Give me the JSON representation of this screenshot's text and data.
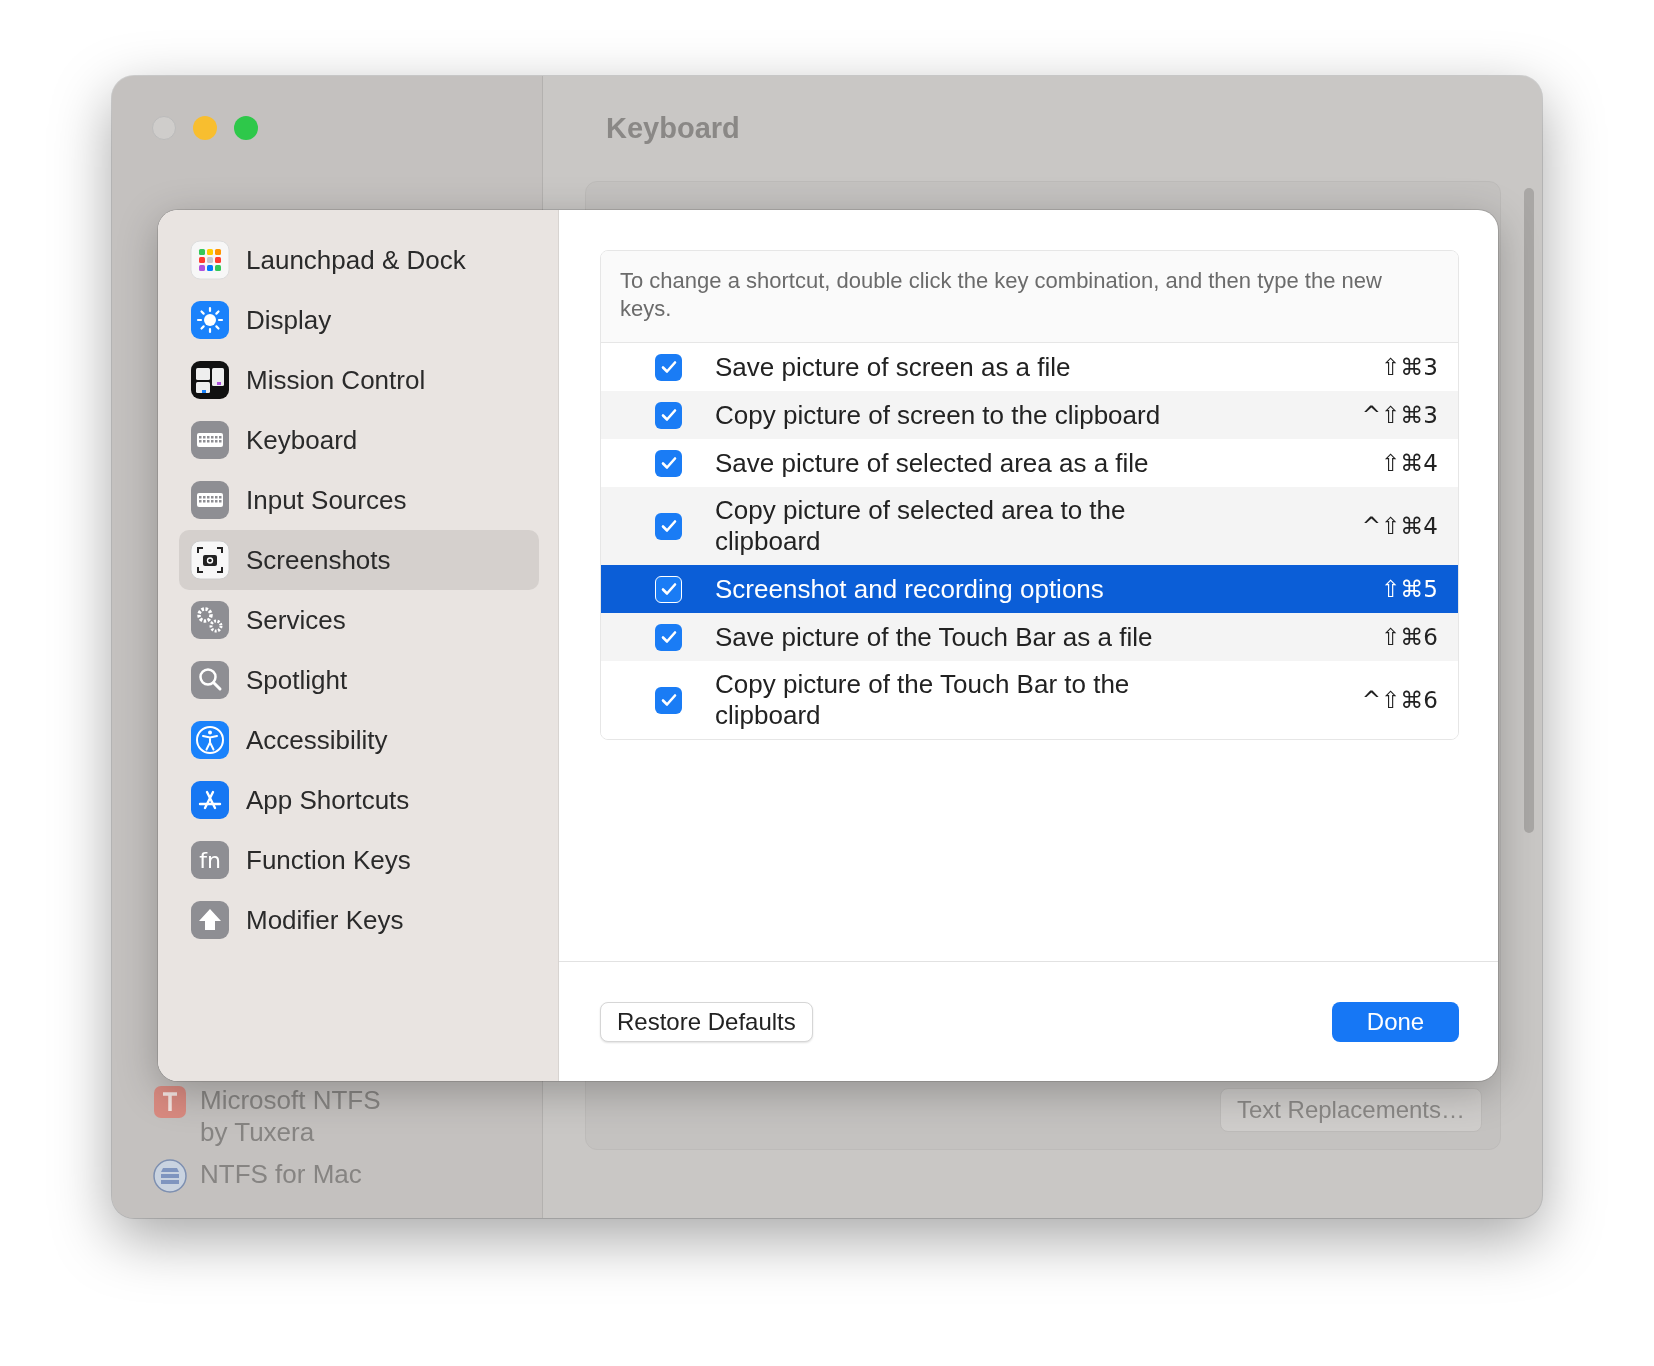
{
  "window": {
    "title": "Keyboard"
  },
  "background_sidebar": {
    "items": [
      {
        "label": "Microsoft NTFS by Tuxera"
      },
      {
        "label": "NTFS for Mac"
      }
    ]
  },
  "background_button": "Text Replacements…",
  "sheet": {
    "sidebar": [
      {
        "label": "Launchpad & Dock",
        "selected": false
      },
      {
        "label": "Display",
        "selected": false
      },
      {
        "label": "Mission Control",
        "selected": false
      },
      {
        "label": "Keyboard",
        "selected": false
      },
      {
        "label": "Input Sources",
        "selected": false
      },
      {
        "label": "Screenshots",
        "selected": true
      },
      {
        "label": "Services",
        "selected": false
      },
      {
        "label": "Spotlight",
        "selected": false
      },
      {
        "label": "Accessibility",
        "selected": false
      },
      {
        "label": "App Shortcuts",
        "selected": false
      },
      {
        "label": "Function Keys",
        "selected": false,
        "icon_text": "fn"
      },
      {
        "label": "Modifier Keys",
        "selected": false
      }
    ],
    "description": "To change a shortcut, double click the key combination, and then type the new keys.",
    "shortcuts": [
      {
        "label": "Save picture of screen as a file",
        "shortcut": "⇧⌘3",
        "checked": true,
        "selected": false
      },
      {
        "label": "Copy picture of screen to the clipboard",
        "shortcut": "^⇧⌘3",
        "checked": true,
        "selected": false
      },
      {
        "label": "Save picture of selected area as a file",
        "shortcut": "⇧⌘4",
        "checked": true,
        "selected": false
      },
      {
        "label": "Copy picture of selected area to the clipboard",
        "shortcut": "^⇧⌘4",
        "checked": true,
        "selected": false
      },
      {
        "label": "Screenshot and recording options",
        "shortcut": "⇧⌘5",
        "checked": true,
        "selected": true
      },
      {
        "label": "Save picture of the Touch Bar as a file",
        "shortcut": "⇧⌘6",
        "checked": true,
        "selected": false
      },
      {
        "label": "Copy picture of the Touch Bar to the clipboard",
        "shortcut": "^⇧⌘6",
        "checked": true,
        "selected": false
      }
    ],
    "buttons": {
      "restore": "Restore Defaults",
      "done": "Done"
    }
  }
}
